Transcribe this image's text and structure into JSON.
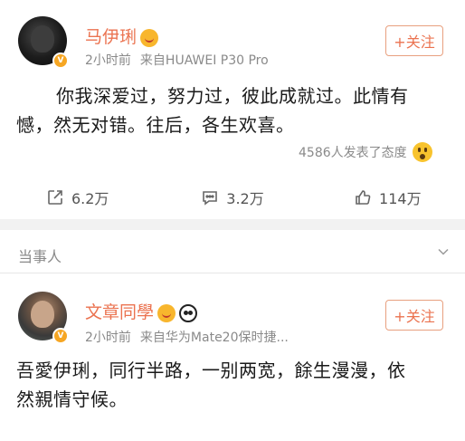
{
  "post1": {
    "username": "马伊琍",
    "time": "2小时前",
    "source": "来自HUAWEI P30 Pro",
    "follow_label": "+关注",
    "content_line1": "你我深爱过，努力过，彼此成就过。此情有",
    "content_line2": "憾，然无对错。往后，各生欢喜。",
    "reactions_text": "4586人发表了态度",
    "actions": {
      "repost_count": "6.2万",
      "comment_count": "3.2万",
      "like_count": "114万"
    }
  },
  "section": {
    "title": "当事人"
  },
  "post2": {
    "username": "文章同學",
    "time": "2小时前",
    "source": "来自华为Mate20保时捷...",
    "follow_label": "+关注",
    "content_line1": "吾愛伊琍，同行半路，一别两宽，餘生漫漫，依",
    "content_line2": "然親情守候。"
  },
  "colors": {
    "accent": "#eb7350",
    "meta_text": "#8a8a8a",
    "divider": "#f2f2f2",
    "verify_badge": "#f6a623"
  },
  "icons": {
    "repost": "share-box-icon",
    "comment": "comment-icon",
    "like": "thumbs-up-icon",
    "reaction": "wow-face-icon",
    "chevron": "chevron-down-icon"
  }
}
